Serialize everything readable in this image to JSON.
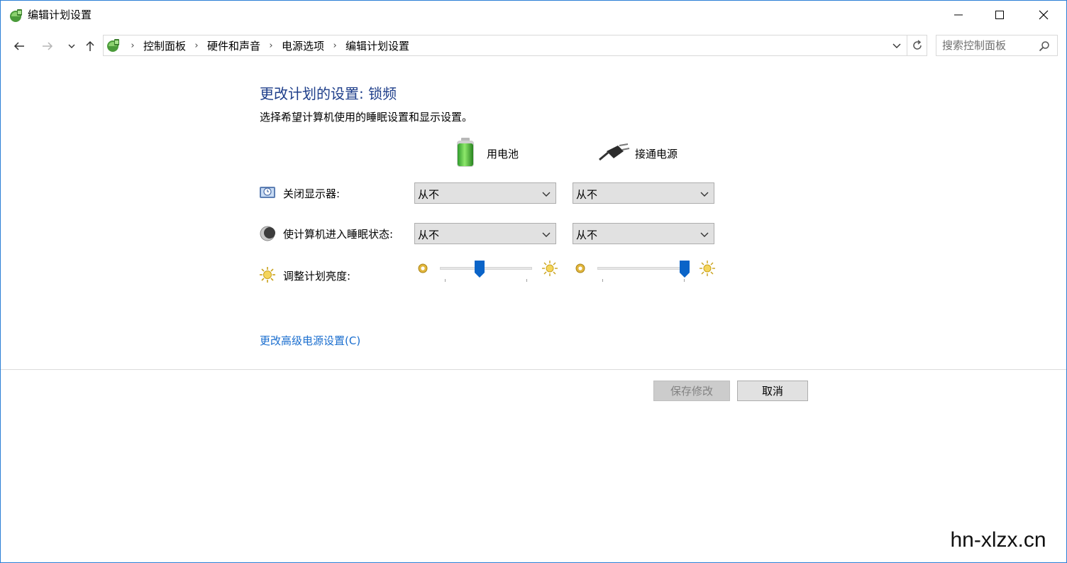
{
  "window": {
    "title": "编辑计划设置",
    "accent": "#2b7fd6"
  },
  "addressbar": {
    "breadcrumbs": [
      "控制面板",
      "硬件和声音",
      "电源选项",
      "编辑计划设置"
    ],
    "search_placeholder": "搜索控制面板"
  },
  "content": {
    "heading": "更改计划的设置: 锁频",
    "subtitle": "选择希望计算机使用的睡眠设置和显示设置。",
    "columns": {
      "battery": "用电池",
      "plugged": "接通电源"
    },
    "rows": [
      {
        "label": "关闭显示器:",
        "battery_value": "从不",
        "plugged_value": "从不"
      },
      {
        "label": "使计算机进入睡眠状态:",
        "battery_value": "从不",
        "plugged_value": "从不"
      }
    ],
    "brightness": {
      "label": "调整计划亮度:",
      "battery_percent": 42,
      "plugged_percent": 100
    },
    "advanced_link": "更改高级电源设置(C)"
  },
  "buttons": {
    "save": "保存修改",
    "cancel": "取消"
  },
  "watermark": "hn-xlzx.cn",
  "colors": {
    "heading": "#1e3e8a",
    "link": "#1a6ecf",
    "slider_thumb": "#0a64c8"
  }
}
